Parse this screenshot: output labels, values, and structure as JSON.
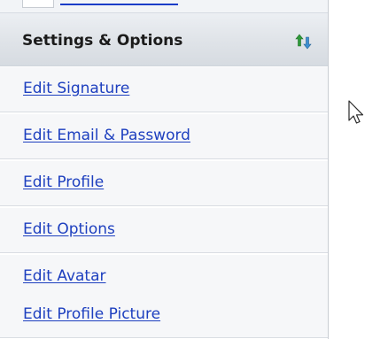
{
  "section": {
    "title": "Settings & Options",
    "icon": "collapse-arrows-icon"
  },
  "menu": {
    "items": [
      {
        "label": "Edit Signature"
      },
      {
        "label": "Edit Email & Password"
      },
      {
        "label": "Edit Profile"
      },
      {
        "label": "Edit Options"
      },
      {
        "label": "Edit Avatar"
      },
      {
        "label": "Edit Profile Picture"
      }
    ]
  },
  "colors": {
    "link": "#1d3fbf",
    "header_text": "#1b1b1b",
    "header_bg": "#dfe3e8",
    "item_bg": "#f6f7f9",
    "icon_green": "#2f9a3a"
  }
}
